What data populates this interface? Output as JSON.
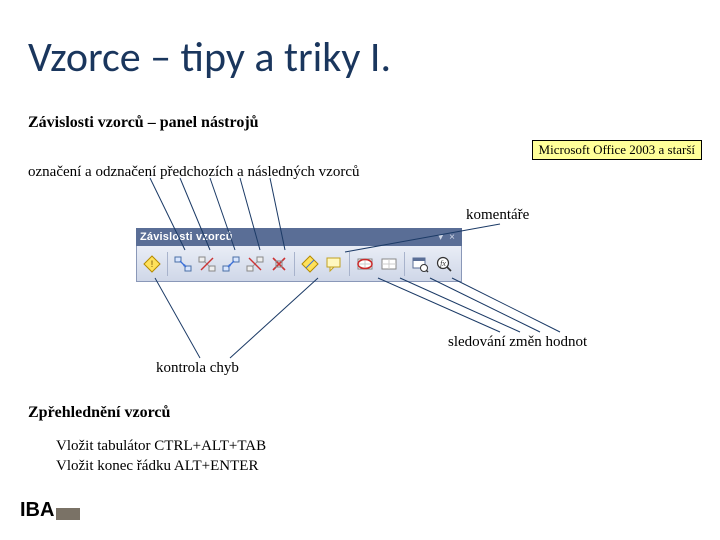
{
  "title": "Vzorce – tipy a triky I.",
  "sub1": "Závislosti vzorců – panel nástrojů",
  "marking": "označení a odznačení předchozích a následných vzorců",
  "msbox": "Microsoft Office 2003 a starší",
  "comments_label": "komentáře",
  "watch_label": "sledování změn hodnot",
  "errchk_label": "kontrola  chyb",
  "sub2": "Zpřehlednění vzorců",
  "ins_tab": "Vložit tabulátor CTRL+ALT+TAB",
  "ins_nl": "Vložit konec řádku ALT+ENTER",
  "toolbar_title": "Závislosti vzorců",
  "toolbar_close": "×",
  "toolbar_menu": "▾",
  "toolbar": {
    "icons": [
      "trace-precedents-icon",
      "remove-precedents-icon",
      "trace-dependents-icon",
      "remove-dependents-icon",
      "remove-all-arrows-icon",
      "trace-error-icon",
      "new-comment-icon",
      "circle-invalid-icon",
      "clear-circles-icon",
      "watch-window-icon",
      "evaluate-formula-icon"
    ]
  },
  "logo_text": "IBA"
}
